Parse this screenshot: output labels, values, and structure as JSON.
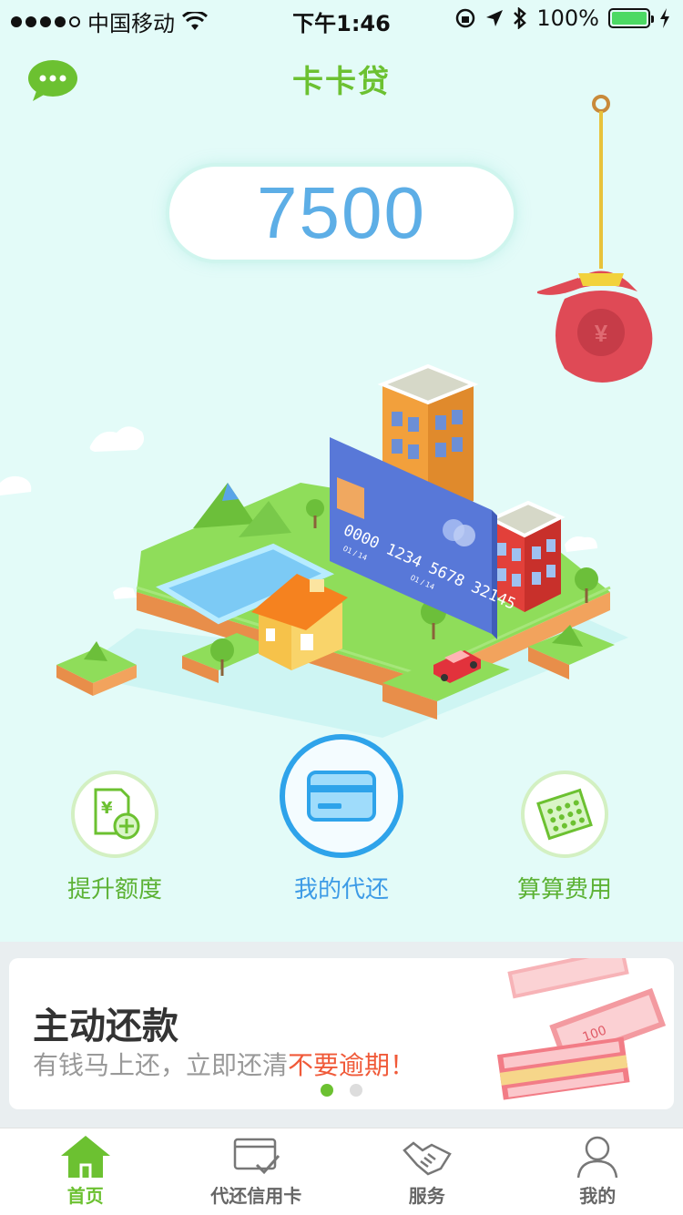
{
  "status_bar": {
    "carrier": "中国移动",
    "time": "下午1:46",
    "battery": "100%"
  },
  "header": {
    "title": "卡卡贷"
  },
  "credit": {
    "amount": "7500"
  },
  "card_illustration": {
    "card_number": "0000 1234 5678 32145",
    "card_valid_left": "01 / 14",
    "card_valid_right": "01 / 14"
  },
  "actions": [
    {
      "label": "提升额度",
      "icon": "document-yuan-plus-icon"
    },
    {
      "label": "我的代还",
      "icon": "credit-card-icon"
    },
    {
      "label": "算算费用",
      "icon": "calculator-icon"
    }
  ],
  "banner": {
    "title": "主动还款",
    "subtitle_plain": "有钱马上还，立即还清",
    "subtitle_highlight": "不要逾期！",
    "pages": 2,
    "active_page": 1
  },
  "tabs": [
    {
      "label": "首页",
      "icon": "home-icon",
      "active": true
    },
    {
      "label": "代还信用卡",
      "icon": "card-check-icon",
      "active": false
    },
    {
      "label": "服务",
      "icon": "handshake-icon",
      "active": false
    },
    {
      "label": "我的",
      "icon": "person-icon",
      "active": false
    }
  ],
  "colors": {
    "brand_green": "#6cc131",
    "amount_blue": "#5daee6",
    "action_blue": "#2ea3ea",
    "highlight_red": "#f05a39",
    "background": "#e3fbf8"
  }
}
